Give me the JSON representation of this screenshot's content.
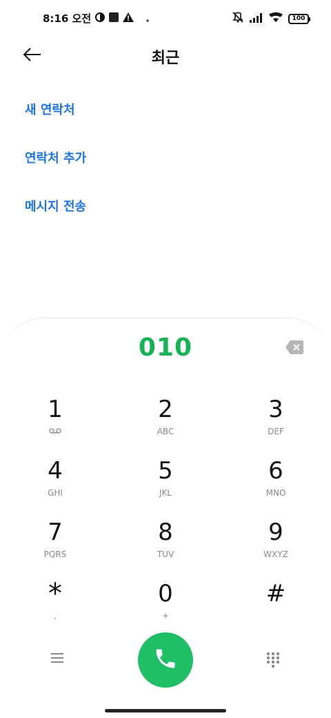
{
  "status_bar": {
    "time": "8:16 오전",
    "battery": "100",
    "left_icons": [
      "data-saver-icon",
      "square-notification-icon",
      "warning-icon",
      "dot-icon"
    ],
    "right_icons": [
      "vibrate-off-icon",
      "signal-icon",
      "wifi-icon",
      "battery-icon"
    ]
  },
  "header": {
    "title": "최근",
    "back_icon": "arrow-left-icon"
  },
  "actions": [
    {
      "label": "새 연락처"
    },
    {
      "label": "연락처 추가"
    },
    {
      "label": "메시지 전송"
    }
  ],
  "dialer": {
    "number": "010",
    "keys": [
      {
        "digit": "1",
        "letters": ""
      },
      {
        "digit": "2",
        "letters": "ABC"
      },
      {
        "digit": "3",
        "letters": "DEF"
      },
      {
        "digit": "4",
        "letters": "GHI"
      },
      {
        "digit": "5",
        "letters": "JKL"
      },
      {
        "digit": "6",
        "letters": "MNO"
      },
      {
        "digit": "7",
        "letters": "PQRS"
      },
      {
        "digit": "8",
        "letters": "TUV"
      },
      {
        "digit": "9",
        "letters": "WXYZ"
      },
      {
        "digit": "*",
        "letters": ","
      },
      {
        "digit": "0",
        "letters": "+"
      },
      {
        "digit": "#",
        "letters": ""
      }
    ]
  },
  "colors": {
    "accent": "#1a73e8",
    "dial_green": "#16b356",
    "call_button": "#1fc065"
  }
}
